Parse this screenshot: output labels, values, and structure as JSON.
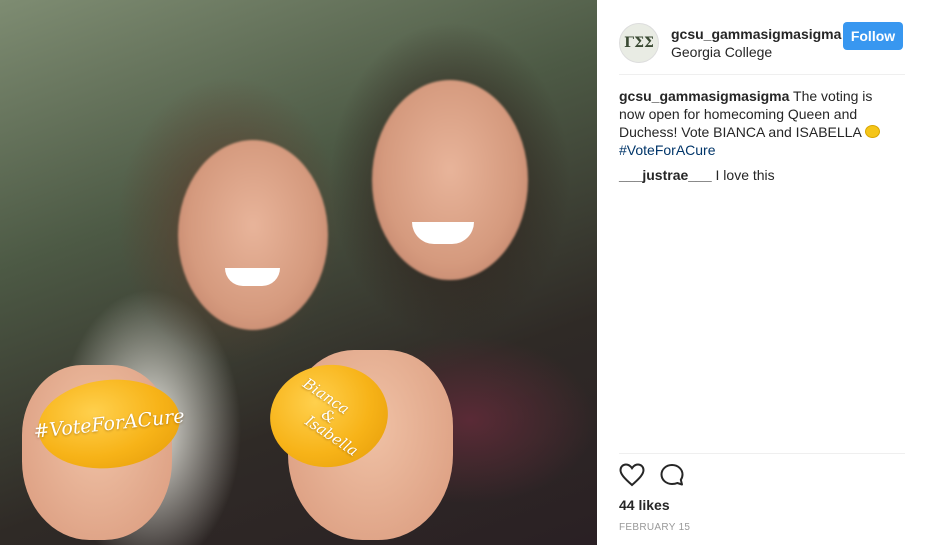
{
  "post": {
    "image": {
      "lemon_left_text": "#VoteForACure",
      "lemon_right_lines": [
        "Bianca",
        "&",
        "Isabella"
      ]
    },
    "header": {
      "username": "gcsu_gammasigmasigma",
      "location": "Georgia College",
      "follow_label": "Follow",
      "avatar_letters": "ΓΣΣ"
    },
    "caption": {
      "username": "gcsu_gammasigmasigma",
      "text": "The voting is now open for homecoming Queen and Duchess! Vote BIANCA and ISABELLA",
      "hashtag": "#VoteForACure"
    },
    "comments": [
      {
        "username": "___justrae___",
        "text": "I love this"
      }
    ],
    "likes": "44 likes",
    "date": "FEBRUARY 15",
    "colors": {
      "follow_button": "#3897f0",
      "hashtag": "#003569"
    },
    "icons": [
      "heart-icon",
      "comment-icon",
      "lemon-emoji-icon"
    ]
  }
}
